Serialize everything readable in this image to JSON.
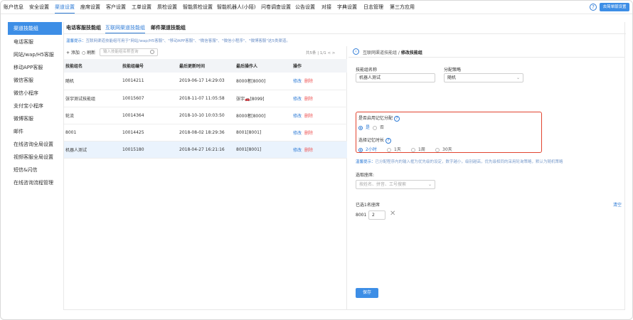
{
  "topnav": {
    "items": [
      "账户信息",
      "安全设置",
      "渠道设置",
      "座席设置",
      "客户设置",
      "工单设置",
      "质检设置",
      "智能质检设置",
      "智能机器人(小陌)",
      "问卷调查设置",
      "公告设置",
      "对接",
      "字典设置",
      "日志管理",
      "第三方应用"
    ],
    "active_index": 2,
    "help_label": "?",
    "wizard_label": "去简单版设置"
  },
  "sidebar": {
    "items": [
      "渠道技能组",
      "电话客服",
      "网站/wap/H5客服",
      "移动APP客服",
      "微信客服",
      "微信小程序",
      "支付宝小程序",
      "微博客服",
      "邮件",
      "在线咨询全局设置",
      "视频客服全局设置",
      "短信&闪信",
      "在线咨询流程管理"
    ],
    "active_index": 0
  },
  "tabs": [
    "电话客服技能组",
    "互联网渠道技能组",
    "邮件渠道技能组"
  ],
  "active_tab": 1,
  "notice": {
    "label": "温馨提示：",
    "text": "互联网渠道技能组可用于\"网站/wap/H5客服\"、\"移动APP客服\"、\"微信客服\"、\"微信小程序\"、\"微博客服\"这5类渠道。"
  },
  "toolbar": {
    "add_label": "+ 添加",
    "refresh_label": "刷新",
    "search_placeholder": "输入技能组名称查询",
    "pager": "共5条 | 1/1 <   >"
  },
  "table": {
    "headers": [
      "技能组名",
      "技能组编号",
      "最后更新时间",
      "最后操作人",
      "操作"
    ],
    "edit_label": "修改",
    "delete_label": "删除",
    "selected_index": 4,
    "rows": [
      [
        "随机",
        "10014211",
        "2019-06-17 14:29:03",
        "8000者[8000]"
      ],
      [
        "张宇测试技能组",
        "10015607",
        "2018-11-07 11:05:58",
        "张宇🚗[8099]"
      ],
      [
        "轮流",
        "10014364",
        "2018-10-10 10:03:50",
        "8000者[8000]"
      ],
      [
        "8001",
        "10014425",
        "2018-08-02 18:29:36",
        "8001[8001]"
      ],
      [
        "机器人测试",
        "10015180",
        "2018-04-27 16:21:16",
        "8001[8001]"
      ]
    ]
  },
  "detail": {
    "crumb_parent": "互联网渠道技能组",
    "crumb_sep": " / ",
    "crumb_current": "修改技能组",
    "back_icon": "‹",
    "name_label": "技能组名称",
    "name_value": "机器人测试",
    "strategy_label": "分配策略",
    "strategy_value": "随机",
    "memory_label": "是否启用记忆分配",
    "memory_options": [
      "是",
      "否"
    ],
    "memory_selected": 0,
    "duration_label": "选择记忆时长",
    "duration_options": [
      "2小时",
      "1天",
      "1周",
      "30天"
    ],
    "duration_selected": 0,
    "hint_label": "温馨提示：",
    "hint_text": "已分配程序内的输入框为优先级的设定，数字越小，级别越高，优先级相同的采用轮询策略，默认为随机策略",
    "agent_label": "选取座席:",
    "agent_placeholder": "按姓名、拼音、工号搜索",
    "selected_count_label": "已选1名座席",
    "clear_label": "清空",
    "selected_agent_name": "8001",
    "selected_agent_priority": "2",
    "save_label": "保存"
  },
  "colors": {
    "accent": "#2e7bd6",
    "button": "#3d8ee6",
    "highlight_box": "#e2442f"
  }
}
